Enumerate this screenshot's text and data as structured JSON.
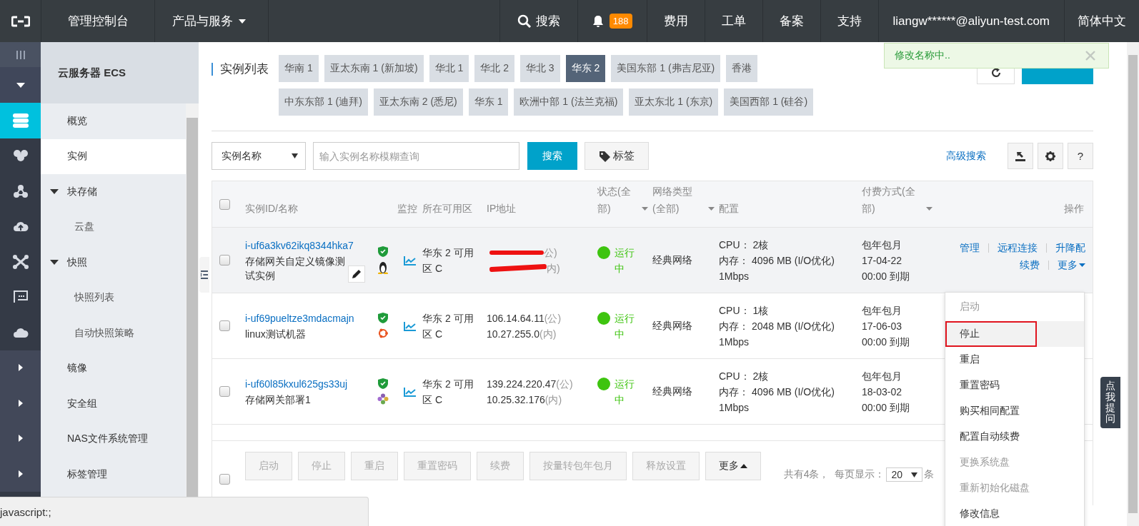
{
  "top_bar": {
    "title": "管理控制台",
    "products_menu": "产品与服务",
    "search": "搜索",
    "notifications_count": "188",
    "links": [
      "费用",
      "工单",
      "备案",
      "支持"
    ],
    "account": "liangw******@aliyun-test.com",
    "language": "简体中文"
  },
  "rail": [
    {
      "kind": "menu",
      "selected": false
    },
    {
      "kind": "collapse",
      "selected": false
    },
    {
      "kind": "server",
      "selected": true
    },
    {
      "kind": "cluster",
      "selected": false
    },
    {
      "kind": "nodes",
      "selected": false
    },
    {
      "kind": "cloud-up",
      "selected": false
    },
    {
      "kind": "hub",
      "selected": false
    },
    {
      "kind": "monitor",
      "selected": false
    },
    {
      "kind": "cloud",
      "selected": false
    },
    {
      "kind": "expand",
      "selected": false
    },
    {
      "kind": "expand",
      "selected": false
    },
    {
      "kind": "expand",
      "selected": false
    },
    {
      "kind": "expand",
      "selected": false
    }
  ],
  "sidebar": {
    "title": "云服务器 ECS",
    "items": [
      {
        "label": "概览",
        "selected": false
      },
      {
        "label": "实例",
        "selected": true
      },
      {
        "label": "块存储",
        "selected": false,
        "expanded": true,
        "children": [
          {
            "label": "云盘",
            "selected": false
          }
        ]
      },
      {
        "label": "快照",
        "selected": false,
        "expanded": true,
        "children": [
          {
            "label": "快照列表",
            "selected": false
          },
          {
            "label": "自动快照策略",
            "selected": false
          }
        ]
      },
      {
        "label": "镜像",
        "selected": false
      },
      {
        "label": "安全组",
        "selected": false
      },
      {
        "label": "NAS文件系统管理",
        "selected": false
      },
      {
        "label": "标签管理",
        "selected": false
      }
    ]
  },
  "page": {
    "title": "实例列表",
    "regions": [
      {
        "label": "华南 1",
        "selected": false
      },
      {
        "label": "亚太东南 1 (新加坡)",
        "selected": false
      },
      {
        "label": "华北 1",
        "selected": false
      },
      {
        "label": "华北 2",
        "selected": false
      },
      {
        "label": "华北 3",
        "selected": false
      },
      {
        "label": "华东 2",
        "selected": true
      },
      {
        "label": "美国东部 1 (弗吉尼亚)",
        "selected": false
      },
      {
        "label": "香港",
        "selected": false
      },
      {
        "label": "中东东部 1 (迪拜)",
        "selected": false
      },
      {
        "label": "亚太东南 2 (悉尼)",
        "selected": false
      },
      {
        "label": "华东 1",
        "selected": false
      },
      {
        "label": "欧洲中部 1 (法兰克福)",
        "selected": false
      },
      {
        "label": "亚太东北 1 (东京)",
        "selected": false
      },
      {
        "label": "美国西部 1 (硅谷)",
        "selected": false
      }
    ],
    "toast": {
      "message": "修改名称中.."
    },
    "search": {
      "field": "实例名称",
      "placeholder": "输入实例名称模糊查询",
      "button": "搜索",
      "tag_button": "标签",
      "advanced": "高级搜索",
      "help": "?"
    },
    "table": {
      "header_checked": false,
      "columns": [
        {
          "label": "实例ID/名称",
          "filter": false
        },
        {
          "label": "监控",
          "filter": false
        },
        {
          "label": "所在可用区",
          "filter": false
        },
        {
          "label": "IP地址",
          "filter": false
        },
        {
          "label": "状态(全部)",
          "filter": true
        },
        {
          "label": "网络类型(全部)",
          "filter": true
        },
        {
          "label": "配置",
          "filter": false
        },
        {
          "label": "付费方式(全部)",
          "filter": true
        },
        {
          "label": "操作",
          "filter": false
        }
      ],
      "rows": [
        {
          "checked": false,
          "hovered": true,
          "id": "i-uf6a3kv62ikq8344hka7",
          "name": "存储网关自定义镜像测试实例",
          "editable": true,
          "os_icon": {
            "kind": "linux"
          },
          "zone": "华东 2 可用区 C",
          "redacted": true,
          "ip_public": "",
          "ip_public_tag": "公)",
          "ip_private": "",
          "ip_private_tag": "内)",
          "status": {
            "label": "运行中",
            "kind": "running"
          },
          "network": "经典网络",
          "config": [
            "CPU： 2核",
            "内存： 4096 MB (I/O优化)",
            "1Mbps"
          ],
          "billing": [
            "包年包月",
            "17-04-22",
            "00:00 到期"
          ],
          "actions": [
            [
              {
                "label": "管理",
                "dropdown": false
              },
              {
                "label": "远程连接",
                "dropdown": false
              },
              {
                "label": "升降配",
                "dropdown": false
              }
            ],
            [
              {
                "label": "续费",
                "dropdown": false
              },
              {
                "label": "更多",
                "dropdown": true
              }
            ]
          ]
        },
        {
          "checked": false,
          "hovered": false,
          "id": "i-uf69pueltze3mdacmajn",
          "name": "linux测试机器",
          "editable": false,
          "os_icon": {
            "kind": "ubuntu"
          },
          "zone": "华东 2 可用区 C",
          "redacted": false,
          "ip_public": "106.14.64.11",
          "ip_public_tag": "(公)",
          "ip_private": "10.27.255.0",
          "ip_private_tag": "(内)",
          "status": {
            "label": "运行中",
            "kind": "running"
          },
          "network": "经典网络",
          "config": [
            "CPU： 1核",
            "内存： 2048 MB (I/O优化)",
            "1Mbps"
          ],
          "billing": [
            "包年包月",
            "17-06-03",
            "00:00 到期"
          ]
        },
        {
          "checked": false,
          "hovered": false,
          "id": "i-uf60l85kxul625gs33uj",
          "name": "存储网关部署1",
          "editable": false,
          "os_icon": {
            "kind": "other"
          },
          "zone": "华东 2 可用区 C",
          "redacted": false,
          "ip_public": "139.224.220.47",
          "ip_public_tag": "(公)",
          "ip_private": "10.25.32.176",
          "ip_private_tag": "(内)",
          "status": {
            "label": "运行中",
            "kind": "running"
          },
          "network": "经典网络",
          "config": [
            "CPU： 2核",
            "内存： 4096 MB (I/O优化)",
            "1Mbps"
          ],
          "billing": [
            "包年包月",
            "18-03-02",
            "00:00 到期"
          ]
        }
      ]
    },
    "bulk_checked": false,
    "bulk_actions": [
      {
        "label": "启动",
        "disabled": true,
        "dropdown": false
      },
      {
        "label": "停止",
        "disabled": true,
        "dropdown": false
      },
      {
        "label": "重启",
        "disabled": true,
        "dropdown": false
      },
      {
        "label": "重置密码",
        "disabled": true,
        "dropdown": false
      },
      {
        "label": "续费",
        "disabled": true,
        "dropdown": false
      },
      {
        "label": "按量转包年包月",
        "disabled": true,
        "dropdown": false
      },
      {
        "label": "释放设置",
        "disabled": true,
        "dropdown": false
      },
      {
        "label": "更多",
        "disabled": false,
        "dropdown": true
      }
    ],
    "pagination": {
      "total": "共有4条，",
      "page_size_label": "每页显示：",
      "page_size": "20",
      "unit": "条"
    },
    "row_menu": [
      {
        "label": "启动",
        "disabled": true,
        "selected": false
      },
      {
        "label": "停止",
        "disabled": false,
        "selected": true
      },
      {
        "label": "重启",
        "disabled": false,
        "selected": false
      },
      {
        "label": "重置密码",
        "disabled": false,
        "selected": false
      },
      {
        "label": "购买相同配置",
        "disabled": false,
        "selected": false
      },
      {
        "label": "配置自动续费",
        "disabled": false,
        "selected": false
      },
      {
        "label": "更换系统盘",
        "disabled": true,
        "selected": false
      },
      {
        "label": "重新初始化磁盘",
        "disabled": true,
        "selected": false
      },
      {
        "label": "修改信息",
        "disabled": false,
        "selected": false
      }
    ]
  },
  "ask_tab": "点我提问",
  "status_bar": "javascript:;"
}
